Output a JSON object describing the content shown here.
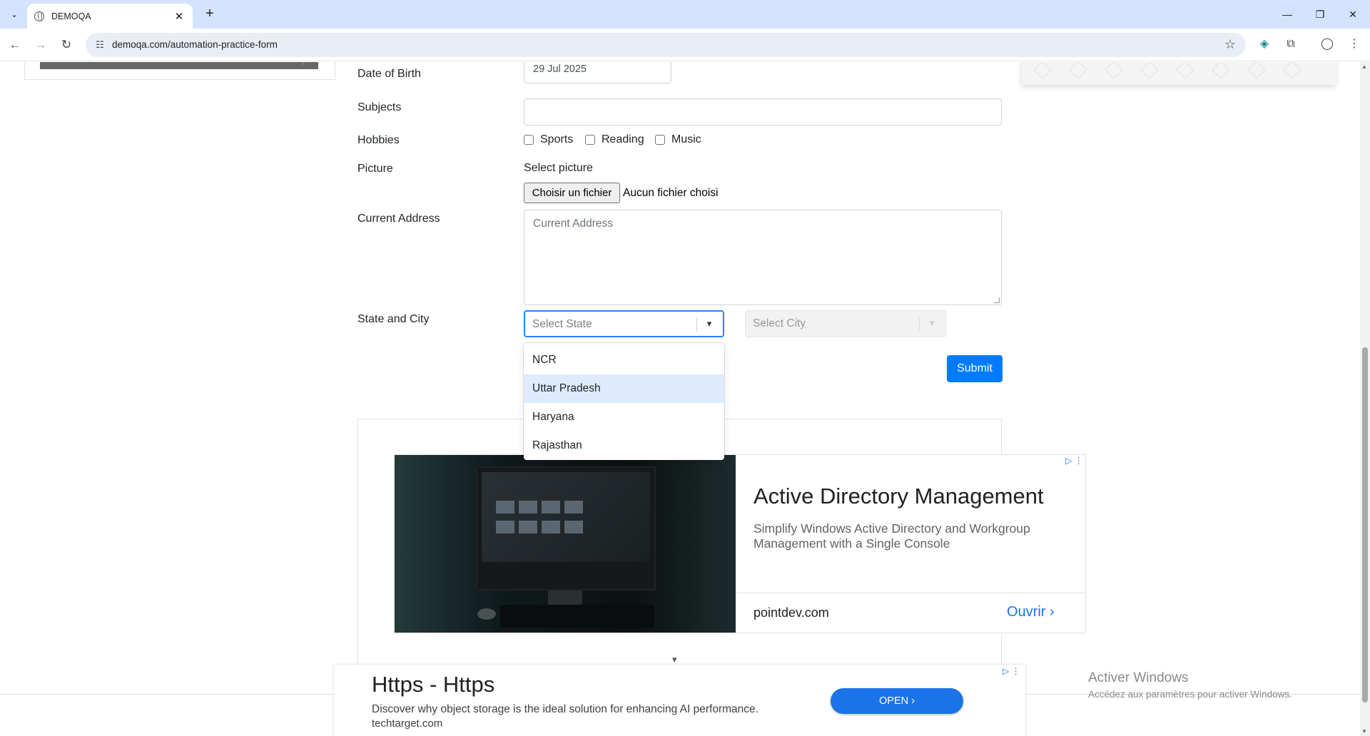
{
  "browser": {
    "tab_title": "DEMOQA",
    "tab_close": "✕",
    "new_tab": "+",
    "url": "demoqa.com/automation-practice-form"
  },
  "icons": {
    "tab_search": "⌄",
    "back": "←",
    "forward": "→",
    "reload": "↻",
    "site_info": "☷",
    "star": "☆",
    "minimize": "—",
    "restore": "❐",
    "close": "✕",
    "extension": "◈",
    "puzzle": "⧉",
    "profile": "◯",
    "menu": "⋮",
    "chevron_down": "▾",
    "chevron_right": "›"
  },
  "form": {
    "dob_label": "Date of Birth",
    "dob_value": "29 Jul 2025",
    "subjects_label": "Subjects",
    "subjects_value": "",
    "hobbies_label": "Hobbies",
    "hobbies": [
      {
        "label": "Sports",
        "checked": false
      },
      {
        "label": "Reading",
        "checked": false
      },
      {
        "label": "Music",
        "checked": false
      }
    ],
    "picture_label": "Picture",
    "select_picture": "Select picture",
    "file_button": "Choisir un fichier",
    "file_status": "Aucun fichier choisi",
    "address_label": "Current Address",
    "address_placeholder": "Current Address",
    "state_city_label": "State and City",
    "state_placeholder": "Select State",
    "city_placeholder": "Select City",
    "submit": "Submit"
  },
  "state_dropdown": {
    "options": [
      "NCR",
      "Uttar Pradesh",
      "Haryana",
      "Rajasthan"
    ],
    "focused": "Uttar Pradesh"
  },
  "ad_main": {
    "title": "Active Directory Management",
    "description": "Simplify Windows Active Directory and Workgroup Management with a Single Console",
    "domain": "pointdev.com",
    "open": "Ouvrir"
  },
  "ad_bottom": {
    "title": "Https - Https",
    "description": "Discover why object storage is the ideal solution for enhancing AI performance.",
    "domain": "techtarget.com",
    "open": "OPEN"
  },
  "watermark": {
    "title": "Activer Windows",
    "subtitle": "Accédez aux paramètres pour activer Windows."
  },
  "colors": {
    "tabbar": "#d3e3fd",
    "primary": "#007bff",
    "focus_border": "#2684ff",
    "option_focus": "#deebff",
    "ad_link": "#1a73e8"
  }
}
